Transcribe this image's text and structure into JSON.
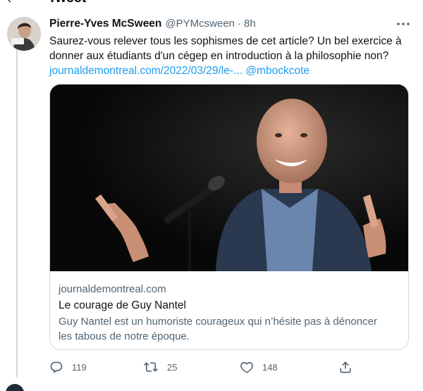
{
  "page": {
    "title": "Tweet"
  },
  "tweet": {
    "author": {
      "name": "Pierre-Yves McSween",
      "handle": "@PYMcsween",
      "separator": "·",
      "time": "8h"
    },
    "text_lines": [
      "Saurez-vous relever tous les sophismes de cet article? Un bel exercice à",
      "donner aux étudiants d'un cégep en introduction à la philosophie non?"
    ],
    "link_text": "journaldemontreal.com/2022/03/29/le-...",
    "mention": "@mbockcote",
    "card": {
      "domain": "journaldemontreal.com",
      "title": "Le courage de Guy Nantel",
      "description_lines": [
        "Guy Nantel est un humoriste courageux qui n’hésite pas à dénoncer",
        "les tabous de notre époque."
      ]
    },
    "actions": {
      "replies": "119",
      "retweets": "25",
      "likes": "148"
    }
  },
  "icons": {
    "back": "arrow-left-icon",
    "more": "more-horizontal-icon",
    "reply": "reply-icon",
    "retweet": "retweet-icon",
    "like": "heart-icon",
    "share": "share-icon"
  },
  "colors": {
    "link": "#1d9bf0",
    "secondary_text": "#536471",
    "border": "#cfd9de"
  }
}
